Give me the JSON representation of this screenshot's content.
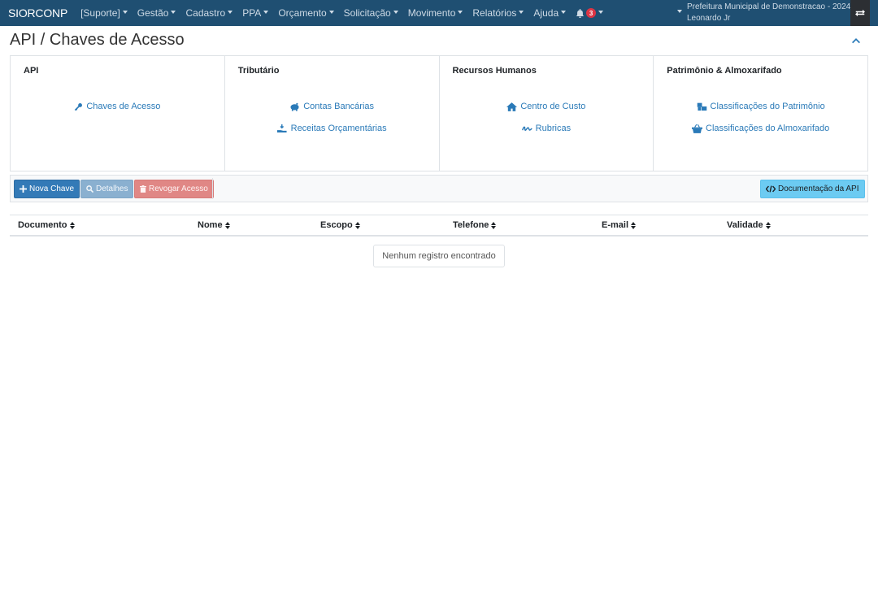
{
  "navbar": {
    "brand": "SIORCONP",
    "items": [
      {
        "label": "[Suporte]"
      },
      {
        "label": "Gestão"
      },
      {
        "label": "Cadastro"
      },
      {
        "label": "PPA"
      },
      {
        "label": "Orçamento"
      },
      {
        "label": "Solicitação"
      },
      {
        "label": "Movimento"
      },
      {
        "label": "Relatórios"
      },
      {
        "label": "Ajuda"
      }
    ],
    "notifications_count": "3",
    "organization": "Prefeitura Municipal de Demonstracao - 2024",
    "user": "Leonardo Jr"
  },
  "page": {
    "title": "API / Chaves de Acesso"
  },
  "modules": [
    {
      "title": "API",
      "links": [
        {
          "label": "Chaves de Acesso",
          "icon": "key-icon"
        }
      ]
    },
    {
      "title": "Tributário",
      "links": [
        {
          "label": "Contas Bancárias",
          "icon": "piggy-bank-icon"
        },
        {
          "label": "Receitas Orçamentárias",
          "icon": "hand-holding-icon"
        }
      ]
    },
    {
      "title": "Recursos Humanos",
      "links": [
        {
          "label": "Centro de Custo",
          "icon": "home-icon"
        },
        {
          "label": "Rubricas",
          "icon": "signature-icon"
        }
      ]
    },
    {
      "title": "Patrimônio & Almoxarifado",
      "links": [
        {
          "label": "Classificações do Patrimônio",
          "icon": "boxes-icon"
        },
        {
          "label": "Classificações do Almoxarifado",
          "icon": "basket-icon"
        }
      ]
    }
  ],
  "toolbar": {
    "new_key": "Nova Chave",
    "details": "Detalhes",
    "revoke": "Revogar Acesso",
    "api_docs": "Documentação da API"
  },
  "table": {
    "columns": [
      "Documento",
      "Nome",
      "Escopo",
      "Telefone",
      "E-mail",
      "Validade"
    ],
    "empty_message": "Nenhum registro encontrado"
  },
  "colors": {
    "navbar": "#1f4f72",
    "link": "#2a7ab8",
    "primary": "#337ab7",
    "danger": "#dc3545",
    "info": "#5bc0eb"
  }
}
